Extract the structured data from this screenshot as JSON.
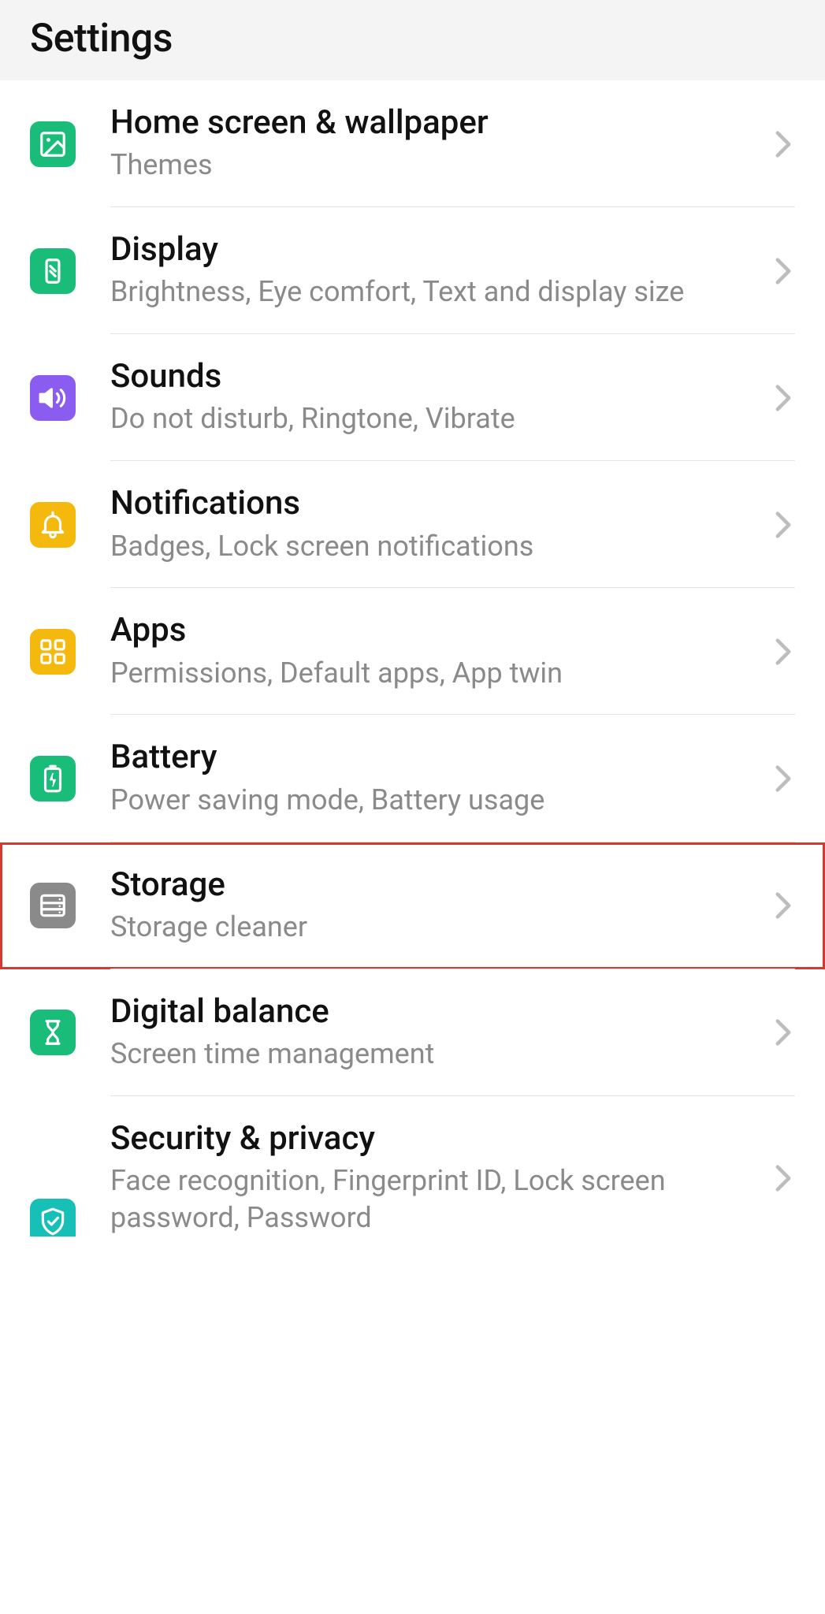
{
  "header": {
    "title": "Settings"
  },
  "items": [
    {
      "title": "Home screen & wallpaper",
      "subtitle": "Themes"
    },
    {
      "title": "Display",
      "subtitle": "Brightness, Eye comfort, Text and display size"
    },
    {
      "title": "Sounds",
      "subtitle": "Do not disturb, Ringtone, Vibrate"
    },
    {
      "title": "Notifications",
      "subtitle": "Badges, Lock screen notifications"
    },
    {
      "title": "Apps",
      "subtitle": "Permissions, Default apps, App twin"
    },
    {
      "title": "Battery",
      "subtitle": "Power saving mode, Battery usage"
    },
    {
      "title": "Storage",
      "subtitle": "Storage cleaner"
    },
    {
      "title": "Digital balance",
      "subtitle": "Screen time management"
    },
    {
      "title": "Security & privacy",
      "subtitle": "Face recognition, Fingerprint ID, Lock screen password, Password"
    }
  ],
  "highlight_index": 6
}
